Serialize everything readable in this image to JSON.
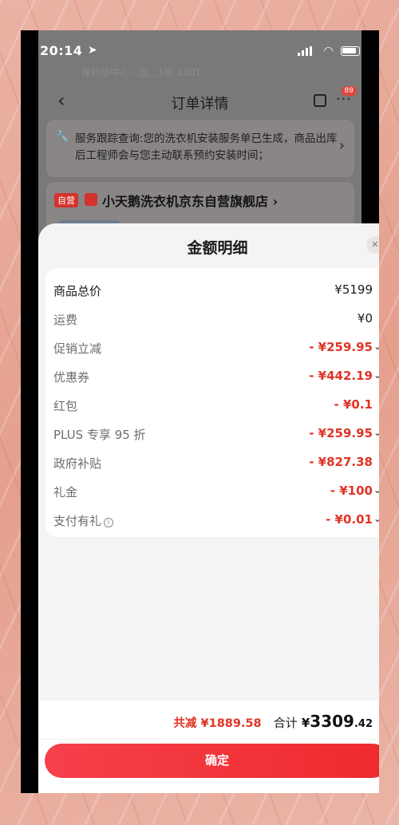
{
  "status_bar": {
    "time": "20:14",
    "location_icon": "location-arrow-icon"
  },
  "background_header": {
    "ghost_address": "保利华中心…区…1栋 1301",
    "title": "订单详情",
    "more_badge": "89"
  },
  "service_notice": {
    "text": "服务跟踪查询:您的洗衣机安装服务单已生成，商品出库后工程师会与您主动联系预约安装时间；"
  },
  "store": {
    "tag": "自营",
    "name": "小天鹅洗衣机京东自营旗舰店 ›"
  },
  "sheet": {
    "title": "金额明细",
    "close_icon": "close-icon",
    "rows": [
      {
        "label": "商品总价",
        "amount": "¥5199",
        "expandable": false
      },
      {
        "label": "运费",
        "amount": "¥0",
        "expandable": false
      },
      {
        "label": "促销立减",
        "amount": "- ¥259.95",
        "expandable": true
      },
      {
        "label": "优惠券",
        "amount": "- ¥442.19",
        "expandable": true
      },
      {
        "label": "红包",
        "amount": "- ¥0.1",
        "expandable": false
      },
      {
        "label": "PLUS 专享 95 折",
        "amount": "- ¥259.95",
        "expandable": true
      },
      {
        "label": "政府补贴",
        "amount": "- ¥827.38",
        "expandable": false
      },
      {
        "label": "礼金",
        "amount": "- ¥100",
        "expandable": true
      },
      {
        "label": "支付有礼",
        "amount": "- ¥0.01",
        "expandable": true
      }
    ],
    "footer": {
      "reduce_label": "共减",
      "reduce_amount": "¥1889.58",
      "total_label": "合计",
      "total_currency": "¥",
      "total_integer": "3309",
      "total_decimal": ".42",
      "confirm_label": "确定"
    }
  },
  "colors": {
    "accent_red": "#e03426",
    "button_red": "#f0333a"
  }
}
